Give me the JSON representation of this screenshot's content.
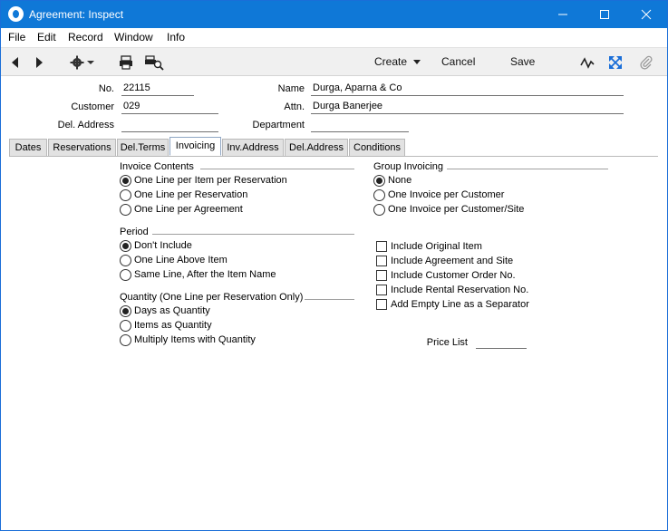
{
  "window": {
    "title": "Agreement: Inspect"
  },
  "menu": [
    "File",
    "Edit",
    "Record",
    "Window",
    "Info"
  ],
  "toolbar": {
    "create_label": "Create",
    "cancel_label": "Cancel",
    "save_label": "Save"
  },
  "header": {
    "no_label": "No.",
    "no_value": "22115",
    "customer_label": "Customer",
    "customer_value": "029",
    "deladdress_label": "Del. Address",
    "deladdress_value": "",
    "name_label": "Name",
    "name_value": "Durga, Aparna & Co",
    "attn_label": "Attn.",
    "attn_value": "Durga Banerjee",
    "department_label": "Department",
    "department_value": ""
  },
  "tabs": [
    "Dates",
    "Reservations",
    "Del.Terms",
    "Invoicing",
    "Inv.Address",
    "Del.Address",
    "Conditions"
  ],
  "active_tab": "Invoicing",
  "invoice_contents": {
    "title": "Invoice Contents",
    "options": [
      "One Line per Item per Reservation",
      "One Line per Reservation",
      "One Line per Agreement"
    ],
    "selected": 0
  },
  "period": {
    "title": "Period",
    "options": [
      "Don't Include",
      "One Line Above Item",
      "Same Line, After the Item Name"
    ],
    "selected": 0
  },
  "quantity": {
    "title": "Quantity (One Line per Reservation Only)",
    "options": [
      "Days as Quantity",
      "Items as Quantity",
      "Multiply Items with Quantity"
    ],
    "selected": 0
  },
  "group_invoicing": {
    "title": "Group Invoicing",
    "options": [
      "None",
      "One Invoice per Customer",
      "One Invoice per Customer/Site"
    ],
    "selected": 0
  },
  "checkboxes": [
    {
      "label": "Include Original Item",
      "checked": false
    },
    {
      "label": "Include Agreement and Site",
      "checked": false
    },
    {
      "label": "Include Customer Order No.",
      "checked": false
    },
    {
      "label": "Include Rental Reservation No.",
      "checked": false
    },
    {
      "label": "Add Empty Line as a Separator",
      "checked": false
    }
  ],
  "price_list": {
    "label": "Price List",
    "value": ""
  },
  "colors": {
    "titlebar": "#0f78d7",
    "toolbar": "#f0f0f0",
    "tab_active_border": "#8fa6c4"
  }
}
